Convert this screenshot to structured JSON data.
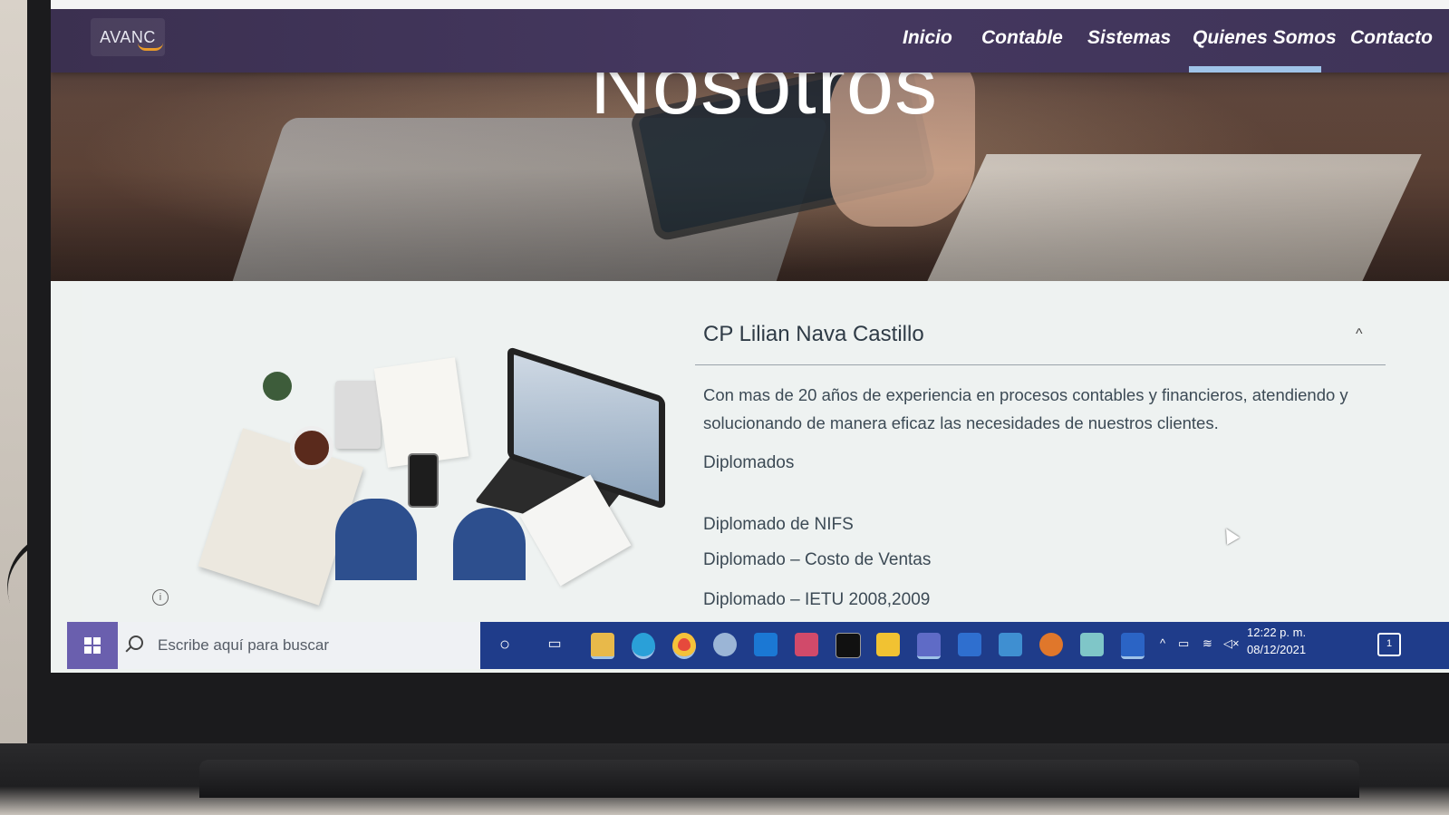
{
  "site": {
    "logo": "AVANC",
    "nav": [
      {
        "label": "Inicio",
        "active": false
      },
      {
        "label": "Contable",
        "active": false
      },
      {
        "label": "Sistemas",
        "active": false
      },
      {
        "label": "Quienes Somos",
        "active": true
      },
      {
        "label": "Contacto",
        "active": false
      }
    ],
    "hero_title": "Nosotros",
    "accordion": {
      "title": "CP Lilian Nava Castillo",
      "expanded": true,
      "description": "Con mas de 20 años de experiencia en procesos contables y financieros, atendiendo y solucionando de manera eficaz las necesidades de nuestros clientes.",
      "section_label": "Diplomados",
      "items": [
        "Diplomado de NIFS",
        "Diplomado – Costo de Ventas",
        "Diplomado – IETU 2008,2009"
      ]
    },
    "colors": {
      "navbar": "#3f3458",
      "nav_active_underline": "#9fc3e8",
      "panel_bg": "#eef2f1"
    }
  },
  "taskbar": {
    "search_placeholder": "Escribe aquí para buscar",
    "icons": [
      "cortana-icon",
      "task-view-icon",
      "file-explorer-icon",
      "edge-icon",
      "chrome-icon",
      "app-icon",
      "outlook-icon",
      "snip-icon",
      "terminal-icon",
      "files-icon",
      "teams-icon",
      "defender-icon",
      "tools-icon",
      "remote-icon",
      "notes-icon",
      "word-icon"
    ],
    "clock": {
      "time": "12:22 p. m.",
      "date": "08/12/2021"
    }
  }
}
